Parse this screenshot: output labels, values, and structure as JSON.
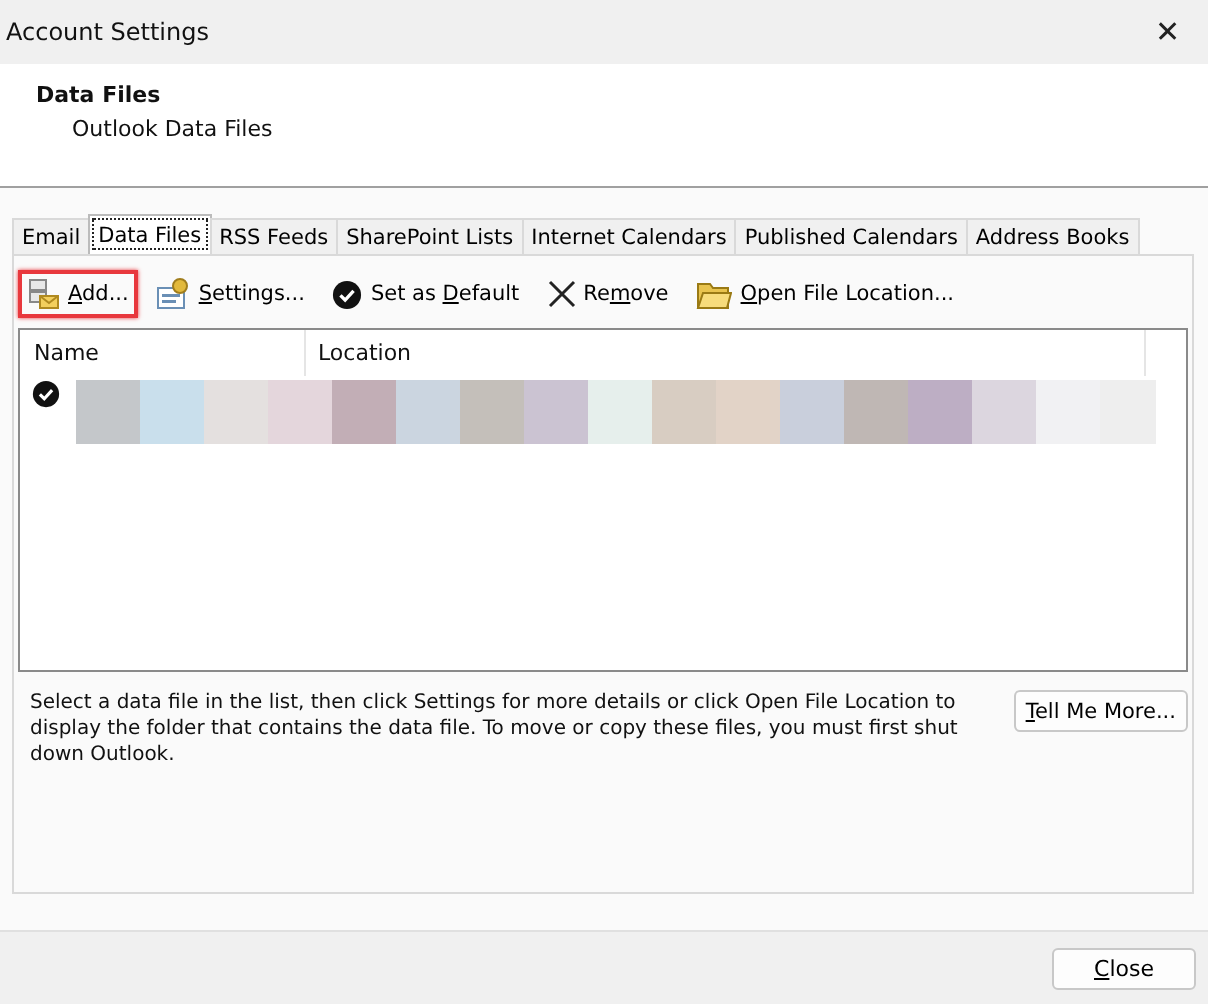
{
  "window": {
    "title": "Account Settings",
    "close_glyph": "✕"
  },
  "header": {
    "title": "Data Files",
    "subtitle": "Outlook Data Files"
  },
  "tabs": [
    {
      "label": "Email",
      "selected": false
    },
    {
      "label": "Data Files",
      "selected": true
    },
    {
      "label": "RSS Feeds",
      "selected": false
    },
    {
      "label": "SharePoint Lists",
      "selected": false
    },
    {
      "label": "Internet Calendars",
      "selected": false
    },
    {
      "label": "Published Calendars",
      "selected": false
    },
    {
      "label": "Address Books",
      "selected": false
    }
  ],
  "toolbar": [
    {
      "kind": "add",
      "key": "A",
      "post": "dd...",
      "highlighted": true
    },
    {
      "kind": "settings",
      "key": "S",
      "post": "ettings...",
      "highlighted": false
    },
    {
      "kind": "default",
      "pre": "Set as ",
      "key": "D",
      "post": "efault",
      "highlighted": false
    },
    {
      "kind": "remove",
      "pre": "Re",
      "key": "m",
      "post": "ove",
      "highlighted": false
    },
    {
      "kind": "open",
      "key": "O",
      "post": "pen File Location...",
      "highlighted": false
    }
  ],
  "table": {
    "columns": [
      "Name",
      "Location"
    ],
    "rows": [
      {
        "default": true,
        "kind": "redacted"
      }
    ]
  },
  "description": "Select a data file in the list, then click Settings for more details or click Open File Location to display the folder that contains the data file. To move or copy these files, you must first shut down Outlook.",
  "tell_more": {
    "key": "T",
    "post": "ell Me More..."
  },
  "close_button": {
    "key": "C",
    "post": "lose"
  }
}
